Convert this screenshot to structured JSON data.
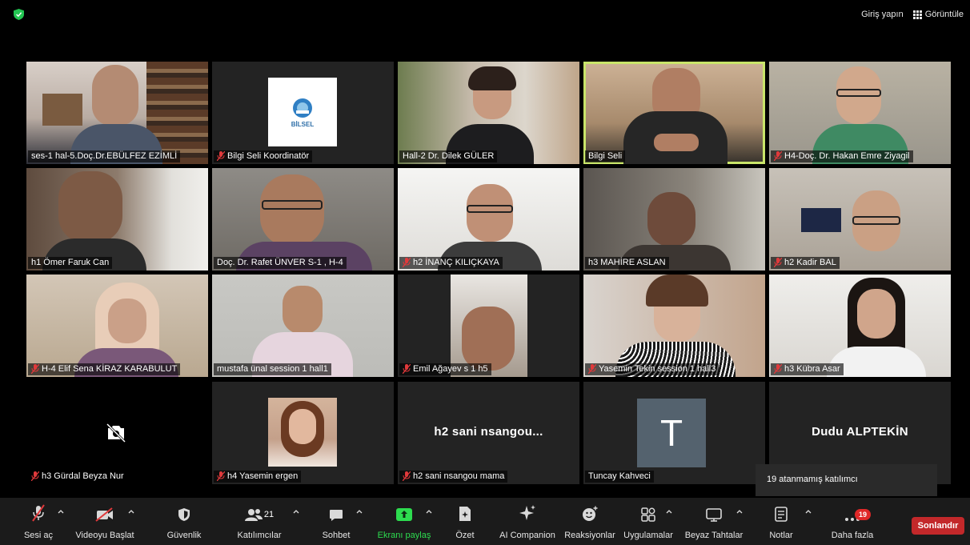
{
  "header": {
    "sign_in": "Giriş yapın",
    "view": "Görüntüle"
  },
  "participants": [
    {
      "name": "ses-1 hal-5.Doç.Dr.EBÜLFEZ EZİMLİ",
      "muted": false,
      "video": true
    },
    {
      "name": "Bilgi Seli Koordinatör",
      "muted": true,
      "video": false,
      "logo_text": "BİLSEL"
    },
    {
      "name": "Hall-2 Dr. Dilek GÜLER",
      "muted": false,
      "video": true
    },
    {
      "name": "Bilgi Seli",
      "muted": false,
      "video": true,
      "active_speaker": true
    },
    {
      "name": "H4-Doç. Dr. Hakan Emre Ziyagil",
      "muted": true,
      "video": true
    },
    {
      "name": "h1 Ömer Faruk Can",
      "muted": false,
      "video": true
    },
    {
      "name": "Doç. Dr. Rafet ÜNVER S-1 , H-4",
      "muted": false,
      "video": true
    },
    {
      "name": "h2 İNANÇ KILIÇKAYA",
      "muted": true,
      "video": true
    },
    {
      "name": "h3 MAHİRE ASLAN",
      "muted": false,
      "video": true
    },
    {
      "name": "h2 Kadir BAL",
      "muted": true,
      "video": true
    },
    {
      "name": "H-4 Elif Sena KİRAZ KARABULUT",
      "muted": true,
      "video": true
    },
    {
      "name": "mustafa ünal session 1 hall1",
      "muted": false,
      "video": true
    },
    {
      "name": "Emil Ağayev s 1 h5",
      "muted": true,
      "video": true
    },
    {
      "name": "Yasemin Tekin session 1 hall3",
      "muted": true,
      "video": true
    },
    {
      "name": "h3 Kübra Asar",
      "muted": true,
      "video": true
    },
    {
      "name": "h3 Gürdal Beyza Nur",
      "muted": true,
      "video": false
    },
    {
      "name": "h4 Yasemin ergen",
      "muted": true,
      "video": false
    },
    {
      "name": "h2 sani nsangou mama",
      "muted": true,
      "video": false,
      "display_name": "h2 sani nsangou..."
    },
    {
      "name": "Tuncay Kahveci",
      "muted": false,
      "video": false,
      "avatar_letter": "T"
    },
    {
      "name": "",
      "muted": false,
      "video": false,
      "display_name": "Dudu ALPTEKİN"
    }
  ],
  "tooltip": "19 atanmamış katılımcı",
  "toolbar": {
    "mute": "Sesi aç",
    "video": "Videoyu Başlat",
    "security": "Güvenlik",
    "participants": "Katılımcılar",
    "participants_count": "21",
    "chat": "Sohbet",
    "share": "Ekranı paylaş",
    "summary": "Özet",
    "ai": "AI Companion",
    "reactions": "Reaksiyonlar",
    "apps": "Uygulamalar",
    "whiteboard": "Beyaz Tahtalar",
    "notes": "Notlar",
    "more": "Daha fazla",
    "more_badge": "19",
    "end": "Sonlandır"
  },
  "colors": {
    "active_border": "#c9e56a",
    "end_button": "#c3282a",
    "share_green": "#2ddc4f",
    "badge_red": "#e02828",
    "muted_red": "#e0393b"
  }
}
